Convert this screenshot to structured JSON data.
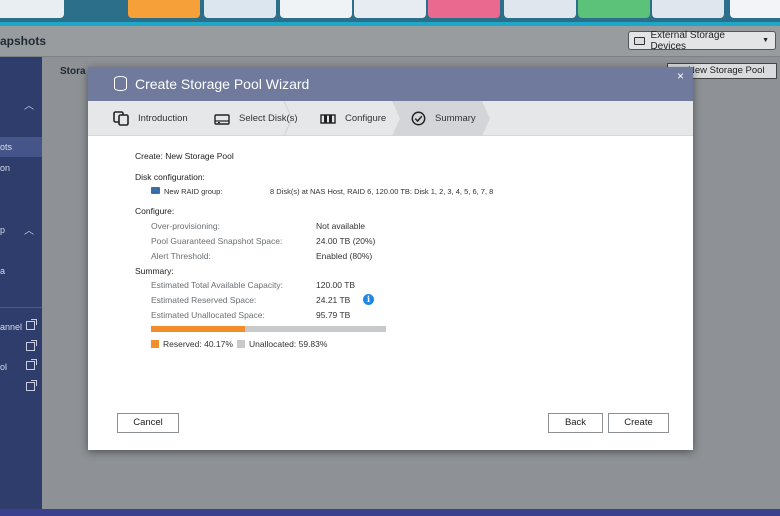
{
  "app": {
    "title_fragment": "apshots",
    "external_storage_label": "External Storage Devices"
  },
  "sidebar": {
    "items": [
      {
        "text": "ots",
        "active": true
      },
      {
        "text": "on"
      },
      {
        "text": "p"
      },
      {
        "text": "a"
      },
      {
        "text": "annel"
      },
      {
        "text": "ol"
      }
    ]
  },
  "main": {
    "title_fragment": "Stora",
    "new_pool_label": "New Storage Pool"
  },
  "dialog": {
    "title": "Create Storage Pool Wizard",
    "close_symbol": "×",
    "steps": [
      {
        "label": "Introduction",
        "icon": "copy-icon"
      },
      {
        "label": "Select Disk(s)",
        "icon": "disk-icon"
      },
      {
        "label": "Configure",
        "icon": "raid-config-icon"
      },
      {
        "label": "Summary",
        "icon": "check-circle-icon",
        "active": true
      }
    ],
    "summary": {
      "create_line": "Create: New Storage Pool",
      "disk_config_heading": "Disk configuration:",
      "raid_group_label": "New RAID group:",
      "raid_group_value": "8 Disk(s) at NAS Host, RAID 6, 120.00 TB: Disk 1, 2, 3, 4, 5, 6, 7, 8",
      "configure_heading": "Configure:",
      "configure_rows": [
        {
          "label": "Over-provisioning:",
          "value": "Not available"
        },
        {
          "label": "Pool Guaranteed Snapshot Space:",
          "value": "24.00 TB (20%)"
        },
        {
          "label": "Alert Threshold:",
          "value": "Enabled (80%)"
        }
      ],
      "summary_heading": "Summary:",
      "summary_rows": [
        {
          "label": "Estimated Total Available Capacity:",
          "value": "120.00 TB"
        },
        {
          "label": "Estimated Reserved Space:",
          "value": "24.21 TB"
        },
        {
          "label": "Estimated Unallocated Space:",
          "value": "95.79 TB"
        }
      ],
      "info_symbol": "i",
      "reserved_fraction": 0.4017,
      "legend": {
        "reserved": "Reserved: 40.17%",
        "unallocated": "Unallocated: 59.83%"
      }
    },
    "buttons": {
      "cancel": "Cancel",
      "back": "Back",
      "create": "Create"
    }
  },
  "colors": {
    "sidebar_bg": "#2f3d6d",
    "dialog_header": "#6f7a9d",
    "reserved": "#f28d2a",
    "unallocated": "#c8c9cb",
    "info": "#1e88e5"
  }
}
